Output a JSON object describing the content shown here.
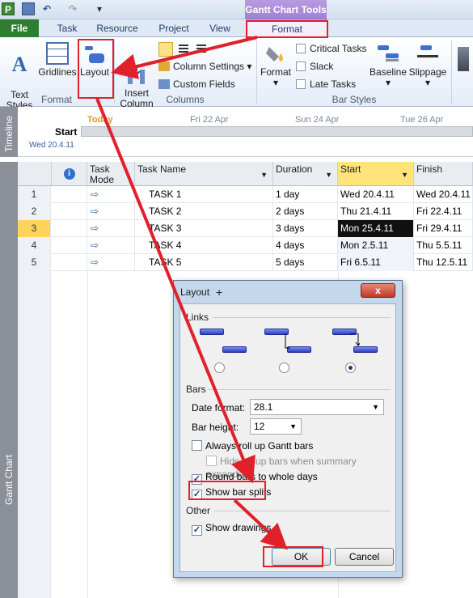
{
  "quick_access": {
    "app_letter": "P",
    "undo": "↶",
    "redo": "↷",
    "more": "▾"
  },
  "contextual_tab_group": "Gantt Chart Tools",
  "tabs": [
    "File",
    "Task",
    "Resource",
    "Project",
    "View",
    "Format"
  ],
  "ribbon": {
    "text_styles": "Text\nStyles",
    "gridlines": "Gridlines",
    "layout": "Layout",
    "insert_column": "Insert\nColumn",
    "column_settings": "Column Settings",
    "custom_fields": "Custom Fields",
    "format": "Format",
    "critical_tasks": "Critical Tasks",
    "slack": "Slack",
    "late_tasks": "Late Tasks",
    "baseline": "Baseline",
    "slippage": "Slippage",
    "groups": {
      "format": "Format",
      "columns": "Columns",
      "bar_styles": "Bar Styles"
    }
  },
  "timeline": {
    "strip_label": "Timeline",
    "today": "Today",
    "start_label": "Start",
    "start_date": "Wed 20.4.11",
    "dates": [
      "Fri 22 Apr",
      "Sun 24 Apr",
      "Tue 26 Apr"
    ]
  },
  "side_label": "Gantt Chart",
  "grid": {
    "headers": {
      "task_mode": "Task\nMode",
      "task_name": "Task Name",
      "duration": "Duration",
      "start": "Start",
      "finish": "Finish"
    },
    "rows": [
      {
        "num": "1",
        "name": "TASK 1",
        "duration": "1 day",
        "start": "Wed 20.4.11",
        "finish": "Wed 20.4.11"
      },
      {
        "num": "2",
        "name": "TASK 2",
        "duration": "2 days",
        "start": "Thu 21.4.11",
        "finish": "Fri 22.4.11"
      },
      {
        "num": "3",
        "name": "TASK 3",
        "duration": "3 days",
        "start": "Mon 25.4.11",
        "finish": "Fri 29.4.11"
      },
      {
        "num": "4",
        "name": "TASK 4",
        "duration": "4 days",
        "start": "Mon 2.5.11",
        "finish": "Thu 5.5.11"
      },
      {
        "num": "5",
        "name": "TASK 5",
        "duration": "5 days",
        "start": "Fri 6.5.11",
        "finish": "Thu 12.5.11"
      }
    ]
  },
  "dialog": {
    "title": "Layout",
    "close": "x",
    "links_label": "Links",
    "links_selected": 3,
    "bars_label": "Bars",
    "date_format_label": "Date format:",
    "date_format_value": "28.1",
    "bar_height_label": "Bar height:",
    "bar_height_value": "12",
    "always_roll_up": "Always roll up Gantt bars",
    "hide_rollup": "Hide rollup bars when summary expanded",
    "round_bars": "Round bars to whole days",
    "show_bar_splits": "Show bar splits",
    "other_label": "Other",
    "show_drawings": "Show drawings",
    "ok": "OK",
    "cancel": "Cancel",
    "checkbox_states": {
      "always_roll_up": false,
      "hide_rollup": false,
      "round_bars": true,
      "show_bar_splits": true,
      "show_drawings": true
    }
  },
  "annotation_color": "#e0212b"
}
